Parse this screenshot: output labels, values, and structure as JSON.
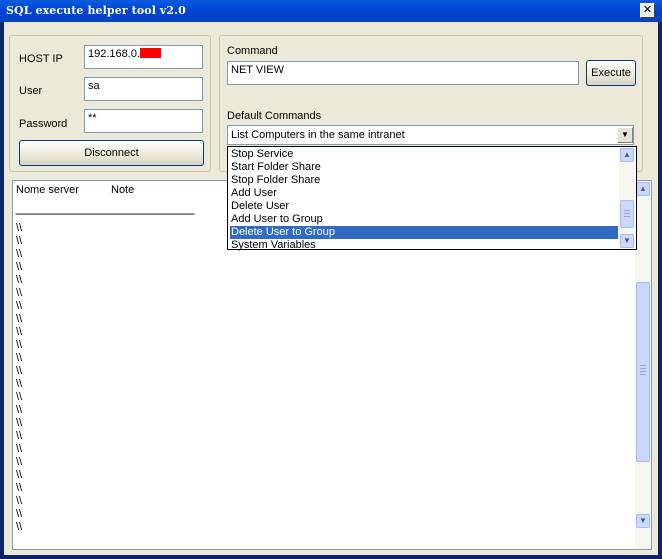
{
  "window": {
    "title": "SQL execute helper tool v2.0",
    "close_glyph": "✕"
  },
  "connection": {
    "host_label": "HOST IP",
    "host_value": "192.168.0.",
    "user_label": "User",
    "user_value": "sa",
    "password_label": "Password",
    "password_value": "**",
    "disconnect_label": "Disconnect"
  },
  "command": {
    "label": "Command",
    "value": "NET VIEW",
    "execute_label": "Execute",
    "default_label": "Default Commands",
    "selected": "List Computers in the same intranet",
    "options": [
      "Stop Service",
      "Start Folder Share",
      "Stop Folder Share",
      "Add User",
      "Delete User",
      "Add User to Group",
      "Delete User to Group",
      "System Variables"
    ],
    "highlighted_index": 6
  },
  "output": {
    "header_col1": "Nome server",
    "header_col2": "Note",
    "separator": "-------------------------------------------------------------------------------",
    "rows": [
      "\\\\",
      "\\\\",
      "\\\\",
      "\\\\",
      "\\\\",
      "\\\\",
      "\\\\",
      "\\\\",
      "\\\\",
      "\\\\",
      "\\\\",
      "\\\\",
      "\\\\",
      "\\\\",
      "\\\\",
      "\\\\",
      "\\\\",
      "\\\\",
      "\\\\",
      "\\\\",
      "\\\\",
      "\\\\",
      "\\\\",
      "\\\\"
    ]
  },
  "icons": {
    "close": "close-icon",
    "combo_arrow": "chevron-down-icon",
    "scroll_up": "chevron-up-icon",
    "scroll_down": "chevron-down-icon"
  },
  "colors": {
    "titlebar": "#0046d5",
    "selection": "#316ac5",
    "redaction": "#ff0000",
    "window_bg": "#ece9d8"
  }
}
